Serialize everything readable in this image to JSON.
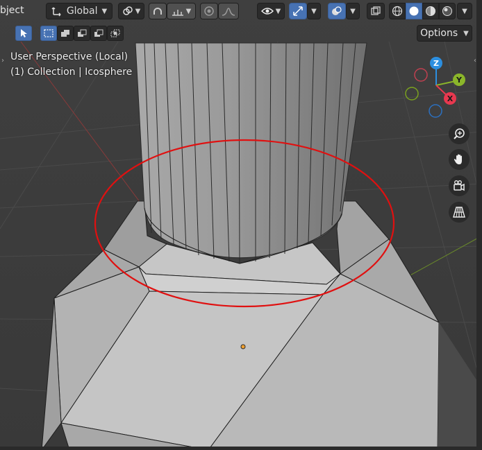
{
  "header": {
    "mode_label": "bject",
    "orientation_label": "Global"
  },
  "overlay": {
    "view_name": "User Perspective (Local)",
    "collection_line": "(1) Collection | Icosphere"
  },
  "toolbar": {
    "options_label": "Options"
  },
  "gizmo": {
    "z_label": "Z",
    "y_label": "Y",
    "x_label": "X"
  },
  "colors": {
    "accent": "#4772b3",
    "axis_x": "#e8384f",
    "axis_y": "#8bb62a",
    "axis_z": "#2c8fe0",
    "annotation_circle": "#e01010",
    "origin_dot": "#f0a030"
  },
  "icons": [
    "transform-orientation-icon",
    "snap-icon",
    "proportional-edit-icon",
    "falloff-icon",
    "visibility-icon",
    "gizmo-icon",
    "overlay-icon",
    "xray-icon",
    "wireframe-shading-icon",
    "solid-shading-icon",
    "material-shading-icon",
    "rendered-shading-icon",
    "zoom-icon",
    "hand-pan-icon",
    "camera-view-icon",
    "perspective-grid-icon"
  ]
}
